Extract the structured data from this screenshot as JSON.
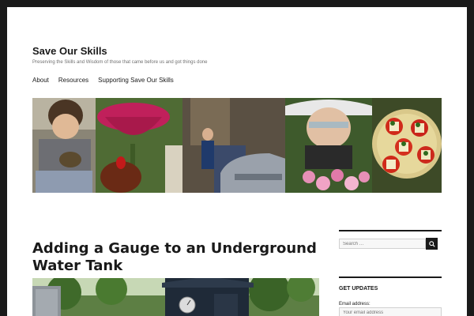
{
  "site": {
    "title": "Save Our Skills",
    "description": "Preserving the Skills and Wisdom of those that came before us and got things done"
  },
  "nav": {
    "items": [
      {
        "label": "About"
      },
      {
        "label": "Resources"
      },
      {
        "label": "Supporting Save Our Skills"
      }
    ]
  },
  "post": {
    "title": "Adding a Gauge to an Underground Water Tank"
  },
  "sidebar": {
    "search": {
      "placeholder": "Search …"
    },
    "updates": {
      "title": "Get Updates",
      "email_label": "Email address:",
      "email_placeholder": "Your email address"
    }
  },
  "colors": {
    "page_bg": "#ffffff",
    "frame_bg": "#1a1a1a",
    "text": "#1a1a1a",
    "muted": "#707070"
  },
  "icons": {
    "search_button": "search-icon"
  }
}
